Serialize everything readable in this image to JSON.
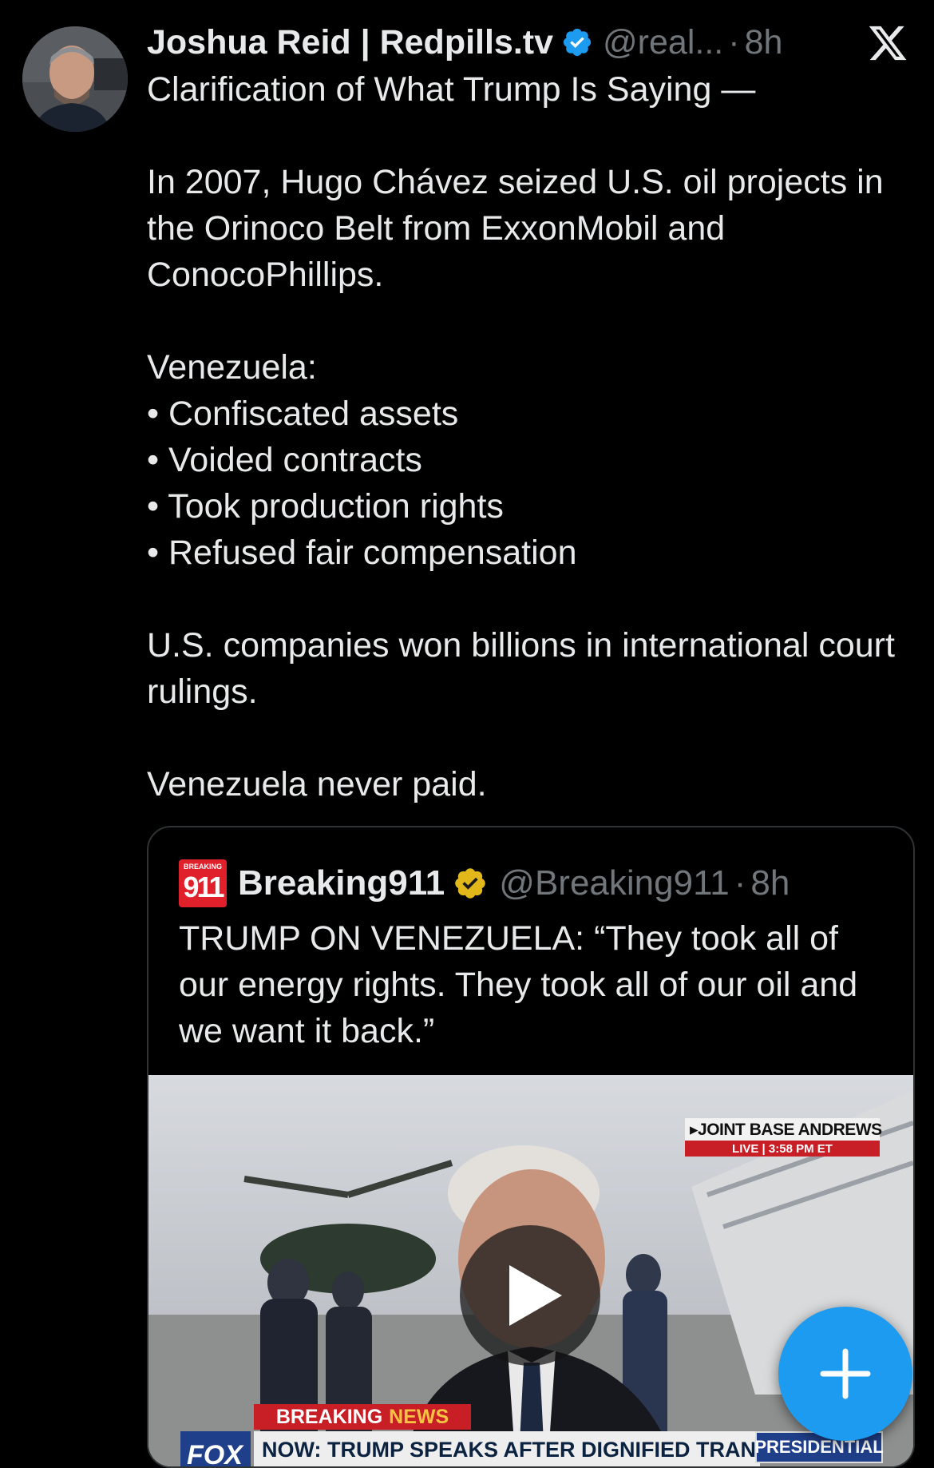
{
  "tweet": {
    "display_name": "Joshua Reid | Redpills.tv",
    "handle": "@real...",
    "separator": "·",
    "time": "8h",
    "text": "Clarification of What Trump Is Saying —\n\nIn 2007, Hugo Chávez seized U.S. oil projects in the Orinoco Belt from ExxonMobil and ConocoPhillips.\n\nVenezuela:\n• Confiscated assets\n• Voided contracts\n• Took production rights\n• Refused fair compensation\n\nU.S. companies won billions in international court rulings.\n\nVenezuela never paid."
  },
  "quote": {
    "logo_small": "BREAKING",
    "logo_big": "911",
    "display_name": "Breaking911",
    "handle": "@Breaking911",
    "separator": "·",
    "time": "8h",
    "text": "TRUMP ON VENEZUELA: “They took all of our energy rights. They took all of our oil and we want it back.”",
    "video": {
      "location": "▸JOINT BASE ANDREWS",
      "live": "LIVE  |  3:58 PM ET",
      "breaking_label": "BREAKING",
      "breaking_news": "NEWS",
      "headline": "NOW: TRUMP SPEAKS AFTER DIGNIFIED TRANSFERS",
      "network": "FOX",
      "tag": "PRESIDENTIAL"
    }
  },
  "icons": {
    "verified": "verified-badge-blue",
    "quote_verified": "verified-badge-gold",
    "platform": "x-logo",
    "play": "play-icon",
    "compose": "plus-icon"
  },
  "colors": {
    "background": "#000000",
    "text": "#e7e9ea",
    "secondary": "#71767b",
    "accent": "#1d9bf0",
    "gold": "#e2b719",
    "border": "#2f3336"
  }
}
